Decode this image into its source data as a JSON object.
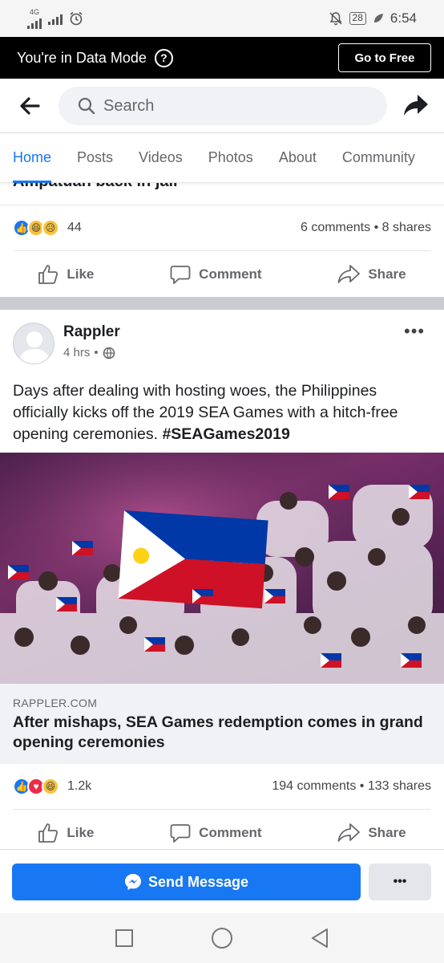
{
  "status_bar": {
    "network_label": "4G",
    "battery": "28",
    "time": "6:54"
  },
  "data_mode": {
    "message": "You're in Data Mode",
    "help_symbol": "?",
    "cta": "Go to Free"
  },
  "search": {
    "placeholder": "Search"
  },
  "tabs": [
    "Home",
    "Posts",
    "Videos",
    "Photos",
    "About",
    "Community"
  ],
  "active_tab": "Home",
  "prev_post": {
    "title_partial": "Ampatuan back in jail",
    "reaction_count": "44",
    "comments": "6 comments",
    "shares": "8 shares",
    "separator": "•"
  },
  "actions": {
    "like": "Like",
    "comment": "Comment",
    "share": "Share"
  },
  "post": {
    "page_name": "Rappler",
    "time_ago": "4 hrs",
    "meta_sep": "•",
    "more": "•••",
    "text": "Days after dealing with hosting woes, the Philippines officially kicks off the 2019 SEA Games with a hitch-free opening ceremonies. ",
    "hashtag": "#SEAGames2019",
    "link_domain": "RAPPLER.COM",
    "link_title": "After mishaps, SEA Games redemption comes in grand opening ceremonies",
    "reaction_count": "1.2k",
    "comments": "194 comments",
    "shares": "133 shares",
    "separator": "•"
  },
  "bottom_bar": {
    "send_message": "Send Message",
    "more": "•••"
  },
  "colors": {
    "accent": "#1877f2",
    "data_bar": "#000000",
    "separator": "#c9ccd1"
  }
}
